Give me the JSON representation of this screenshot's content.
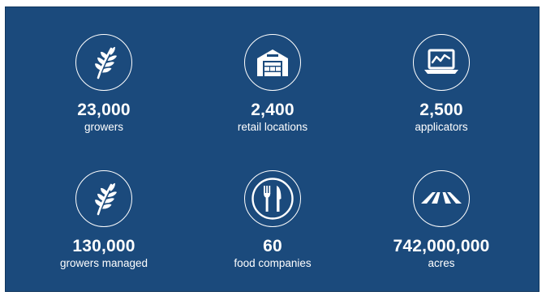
{
  "colors": {
    "background": "#1b4a7c",
    "foreground": "#ffffff"
  },
  "stats": [
    {
      "value": "23,000",
      "label": "growers",
      "icon": "wheat-icon"
    },
    {
      "value": "2,400",
      "label": "retail locations",
      "icon": "warehouse-icon"
    },
    {
      "value": "2,500",
      "label": "applicators",
      "icon": "laptop-chart-icon"
    },
    {
      "value": "130,000",
      "label": "growers managed",
      "icon": "wheat-icon"
    },
    {
      "value": "60",
      "label": "food companies",
      "icon": "fork-knife-icon"
    },
    {
      "value": "742,000,000",
      "label": "acres",
      "icon": "field-rows-icon"
    }
  ]
}
